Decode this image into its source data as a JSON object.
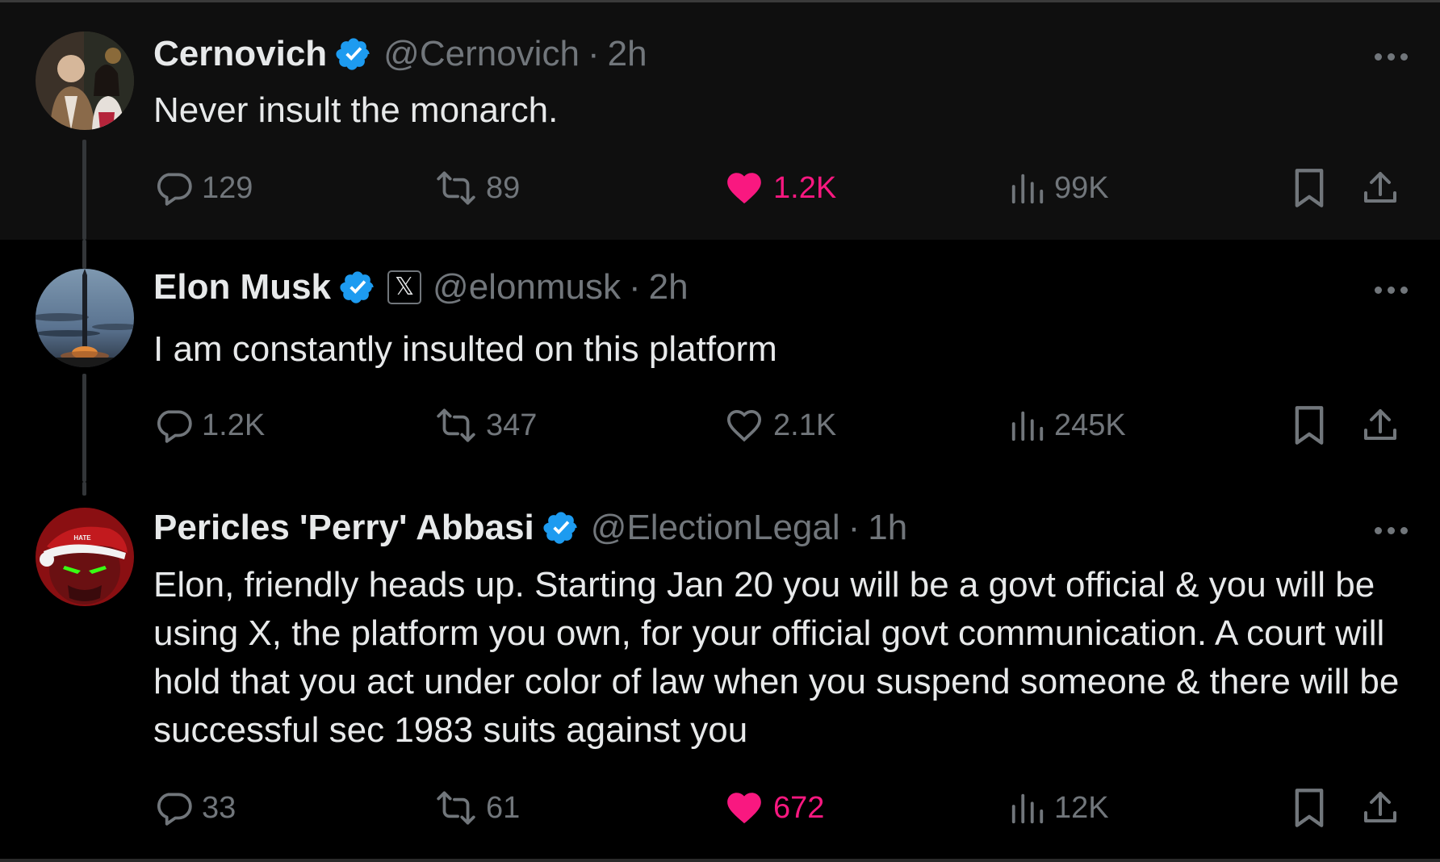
{
  "tweets": [
    {
      "name": "Cernovich",
      "handle": "@Cernovich",
      "separator": "·",
      "time": "2h",
      "text": "Never insult the monarch.",
      "replies": "129",
      "reposts": "89",
      "likes": "1.2K",
      "liked": true,
      "views": "99K"
    },
    {
      "name": "Elon Musk",
      "handle": "@elonmusk",
      "separator": "·",
      "time": "2h",
      "affiliation_badge": "𝕏",
      "text": "I am constantly insulted on this platform",
      "replies": "1.2K",
      "reposts": "347",
      "likes": "2.1K",
      "liked": false,
      "views": "245K"
    },
    {
      "name": "Pericles 'Perry' Abbasi",
      "handle": "@ElectionLegal",
      "separator": "·",
      "time": "1h",
      "text": "Elon, friendly heads up. Starting Jan 20 you will be a govt official & you will be using X, the platform you own, for your official govt communication. A court will hold that you act under color of law when you suspend someone & there will be successful sec 1983 suits against you",
      "replies": "33",
      "reposts": "61",
      "likes": "672",
      "liked": true,
      "views": "12K"
    }
  ],
  "colors": {
    "background": "#000000",
    "highlight_row": "#0f0f0f",
    "text": "#e7e9ea",
    "muted": "#71767b",
    "like": "#f91880",
    "verified": "#1d9bf0"
  },
  "icons": [
    "verified-badge-icon",
    "x-logo-icon",
    "more-icon",
    "reply-icon",
    "repost-icon",
    "like-icon",
    "views-icon",
    "bookmark-icon",
    "share-icon"
  ]
}
